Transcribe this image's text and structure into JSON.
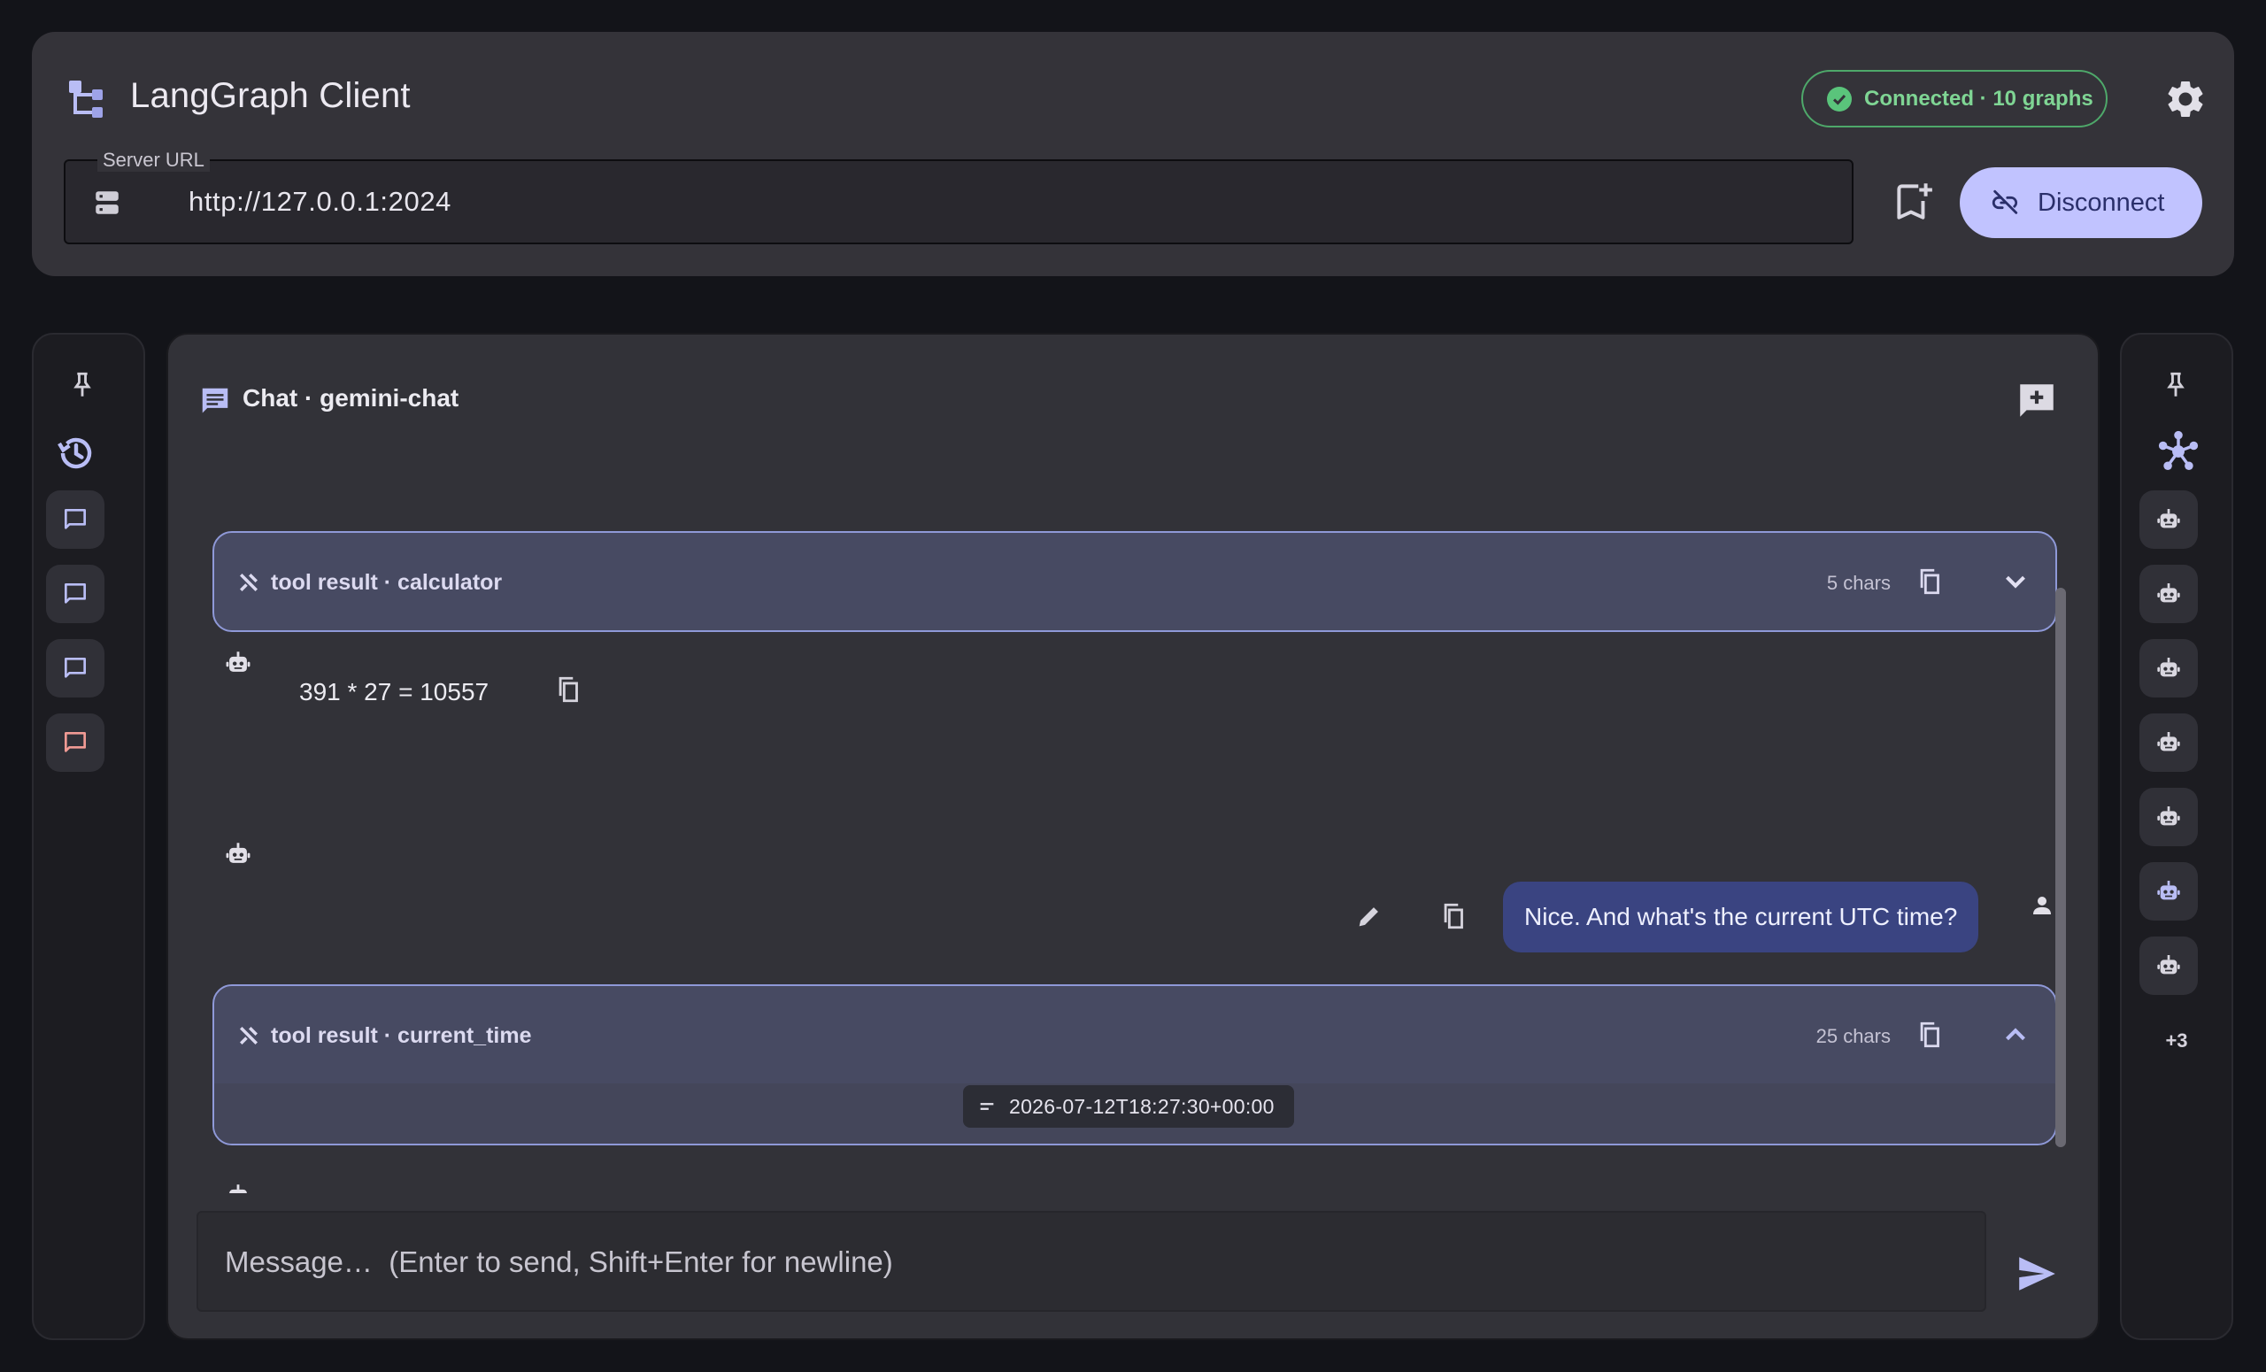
{
  "header": {
    "title": "LangGraph Client",
    "status": "Connected · 10 graphs",
    "server_url_label": "Server URL",
    "server_url": "http://127.0.0.1:2024",
    "disconnect_label": "Disconnect"
  },
  "left_rail": {
    "items": [
      "pin-icon",
      "history-icon",
      "chat-icon",
      "chat-icon",
      "chat-icon",
      "chat-icon"
    ]
  },
  "right_rail": {
    "items": [
      "pin-icon",
      "graph-icon",
      "robot-icon",
      "robot-icon",
      "robot-icon",
      "robot-icon",
      "robot-icon",
      "robot-icon",
      "robot-icon"
    ],
    "more": "+3"
  },
  "chat": {
    "title": "Chat · gemini-chat",
    "tool_result_1": {
      "label": "tool result · calculator",
      "chars": "5 chars"
    },
    "assistant_1": "391 * 27 = 10557",
    "user_1": "Nice. And what's the current UTC time?",
    "tool_result_2": {
      "label": "tool result · current_time",
      "chars": "25 chars",
      "value": "2026-07-12T18:27:30+00:00"
    },
    "composer_placeholder": "Message…  (Enter to send, Shift+Enter for newline)"
  },
  "colors": {
    "accent": "#c1c3ff",
    "connected": "#5ac47b",
    "tool_border": "#8f99d8",
    "user_bubble": "#3a4481",
    "danger_chat": "#f09a94"
  }
}
